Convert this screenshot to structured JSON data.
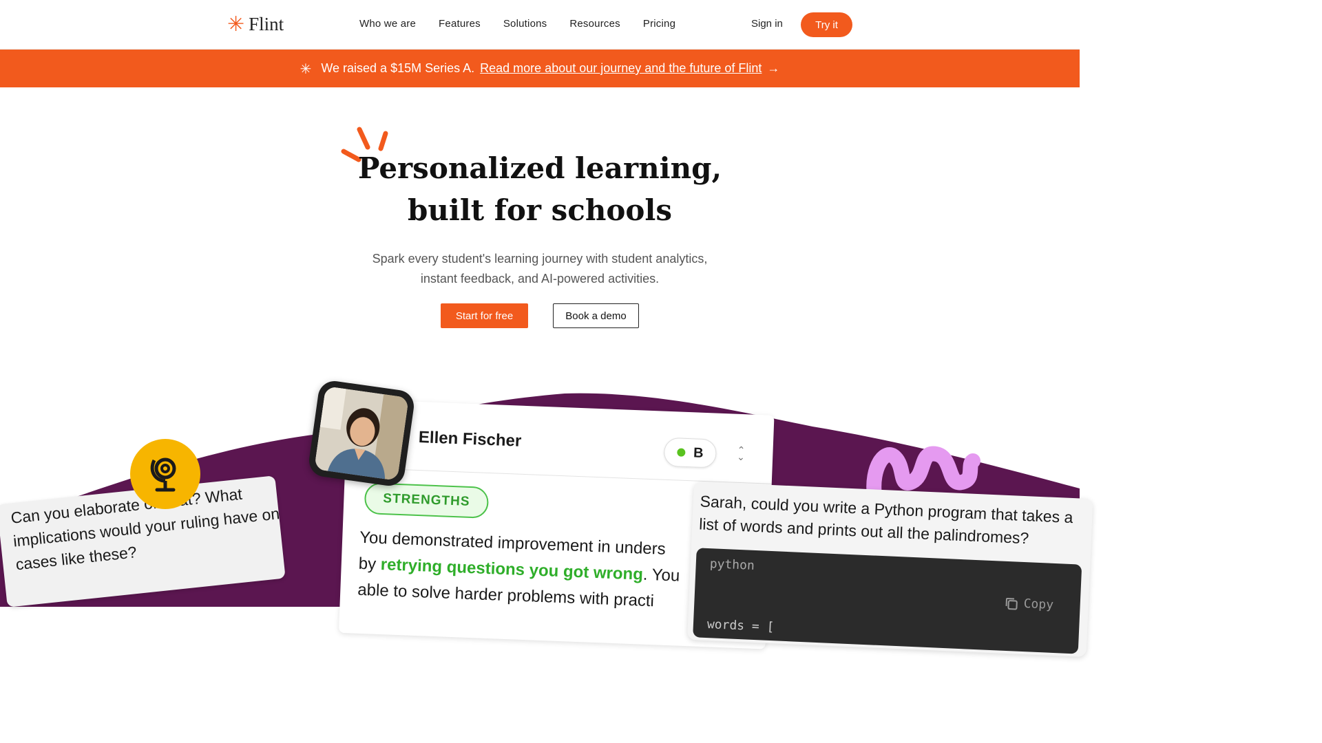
{
  "nav": {
    "logo_text": "Flint",
    "logo_icon": "asterisk-icon",
    "links": [
      "Who we are",
      "Features",
      "Solutions",
      "Resources",
      "Pricing"
    ],
    "signin_label": "Sign in",
    "try_label": "Try it"
  },
  "banner": {
    "icon": "sparkle-icon",
    "text": "We raised a $15M Series A.",
    "link_text": "Read more about our journey and the future of Flint",
    "arrow": "→"
  },
  "hero": {
    "title_line1": "Personalized learning,",
    "title_line2": "built for schools",
    "subtitle_line1": "Spark every student's learning journey with student analytics,",
    "subtitle_line2": "instant feedback, and AI-powered activities.",
    "start_label": "Start for free",
    "demo_label": "Book a demo"
  },
  "illustration": {
    "left_card_text": "Can you elaborate on that? What implications would your ruling have on cases like these?",
    "student_name": "Ellen Fischer",
    "grade": "B",
    "badge": "STRENGTHS",
    "feedback_line1": "You demonstrated improvement in unders",
    "feedback_line2_pre": "by ",
    "feedback_line2_hl": "retrying questions you got wrong",
    "feedback_line2_post": ". You",
    "feedback_line3": "able to solve harder problems with practi",
    "right_card_text": "Sarah, could you write a Python program that takes a list of words and prints out all the palindromes?",
    "code_lang": "python",
    "copy_label": "Copy",
    "code_line": "words = ["
  },
  "colors": {
    "accent": "#f25a1d",
    "purple": "#5b1650",
    "green": "#2fae2a",
    "yellow": "#f7b500",
    "pink": "#e59af0"
  }
}
